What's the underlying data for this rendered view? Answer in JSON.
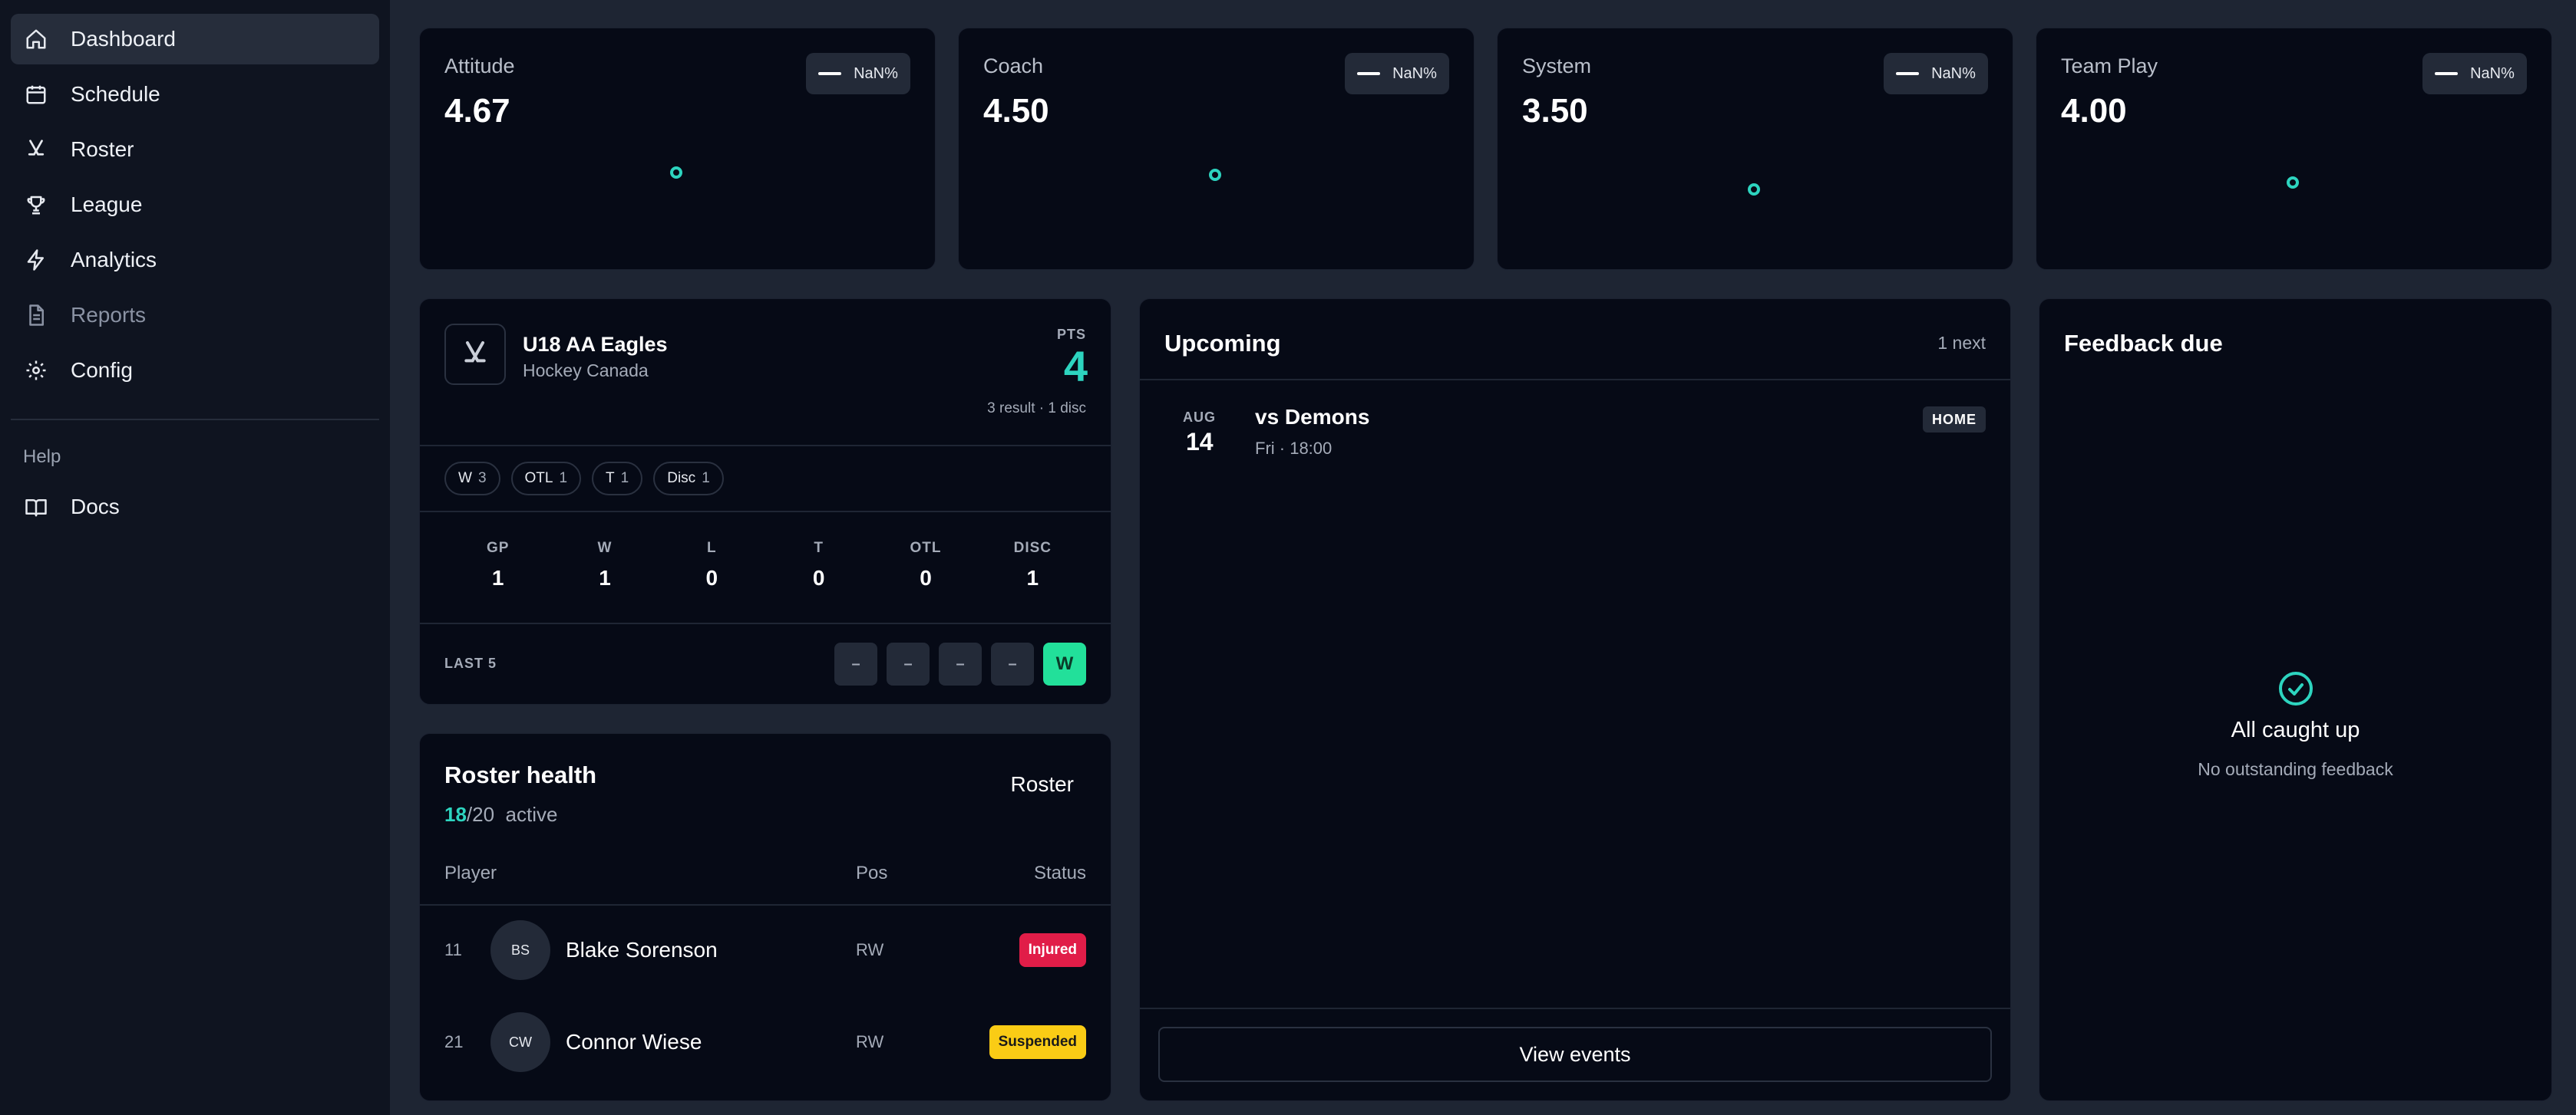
{
  "sidebar": {
    "items": [
      {
        "label": "Dashboard",
        "icon": "home-icon",
        "active": true
      },
      {
        "label": "Schedule",
        "icon": "calendar-icon"
      },
      {
        "label": "Roster",
        "icon": "hockey-sticks-icon"
      },
      {
        "label": "League",
        "icon": "trophy-icon"
      },
      {
        "label": "Analytics",
        "icon": "lightning-icon"
      },
      {
        "label": "Reports",
        "icon": "document-icon",
        "muted": true
      },
      {
        "label": "Config",
        "icon": "gear-icon"
      }
    ],
    "help_label": "Help",
    "help_items": [
      {
        "label": "Docs",
        "icon": "book-icon"
      }
    ]
  },
  "metrics": [
    {
      "title": "Attitude",
      "value": "4.67",
      "badge": "NaN%"
    },
    {
      "title": "Coach",
      "value": "4.50",
      "badge": "NaN%"
    },
    {
      "title": "System",
      "value": "3.50",
      "badge": "NaN%"
    },
    {
      "title": "Team Play",
      "value": "4.00",
      "badge": "NaN%"
    }
  ],
  "team": {
    "name": "U18 AA Eagles",
    "org": "Hockey Canada",
    "pts_label": "PTS",
    "pts_value": "4",
    "pts_sub": "3 result · 1 disc",
    "chips": [
      {
        "label": "W",
        "count": "3"
      },
      {
        "label": "OTL",
        "count": "1"
      },
      {
        "label": "T",
        "count": "1"
      },
      {
        "label": "Disc",
        "count": "1"
      }
    ],
    "stats": [
      {
        "label": "GP",
        "value": "1"
      },
      {
        "label": "W",
        "value": "1"
      },
      {
        "label": "L",
        "value": "0"
      },
      {
        "label": "T",
        "value": "0"
      },
      {
        "label": "OTL",
        "value": "0"
      },
      {
        "label": "DISC",
        "value": "1"
      }
    ],
    "last5_label": "LAST 5",
    "last5": [
      "–",
      "–",
      "–",
      "–",
      "W"
    ]
  },
  "roster": {
    "title": "Roster health",
    "active_count": "18",
    "total": "/20",
    "active_label": "active",
    "button_label": "Roster",
    "columns": {
      "player": "Player",
      "pos": "Pos",
      "status": "Status"
    },
    "players": [
      {
        "number": "11",
        "initials": "BS",
        "name": "Blake Sorenson",
        "pos": "RW",
        "status": "Injured"
      },
      {
        "number": "21",
        "initials": "CW",
        "name": "Connor Wiese",
        "pos": "RW",
        "status": "Suspended"
      }
    ]
  },
  "upcoming": {
    "title": "Upcoming",
    "count": "1 next",
    "event": {
      "month": "AUG",
      "day": "14",
      "name": "vs Demons",
      "time": "Fri · 18:00",
      "badge": "HOME"
    },
    "button_label": "View events"
  },
  "feedback": {
    "title": "Feedback due",
    "empty_title": "All caught up",
    "empty_sub": "No outstanding feedback"
  },
  "colors": {
    "accent": "#2dd4bf",
    "win": "#22e09a",
    "injured": "#e11d48",
    "suspended": "#facc15"
  }
}
